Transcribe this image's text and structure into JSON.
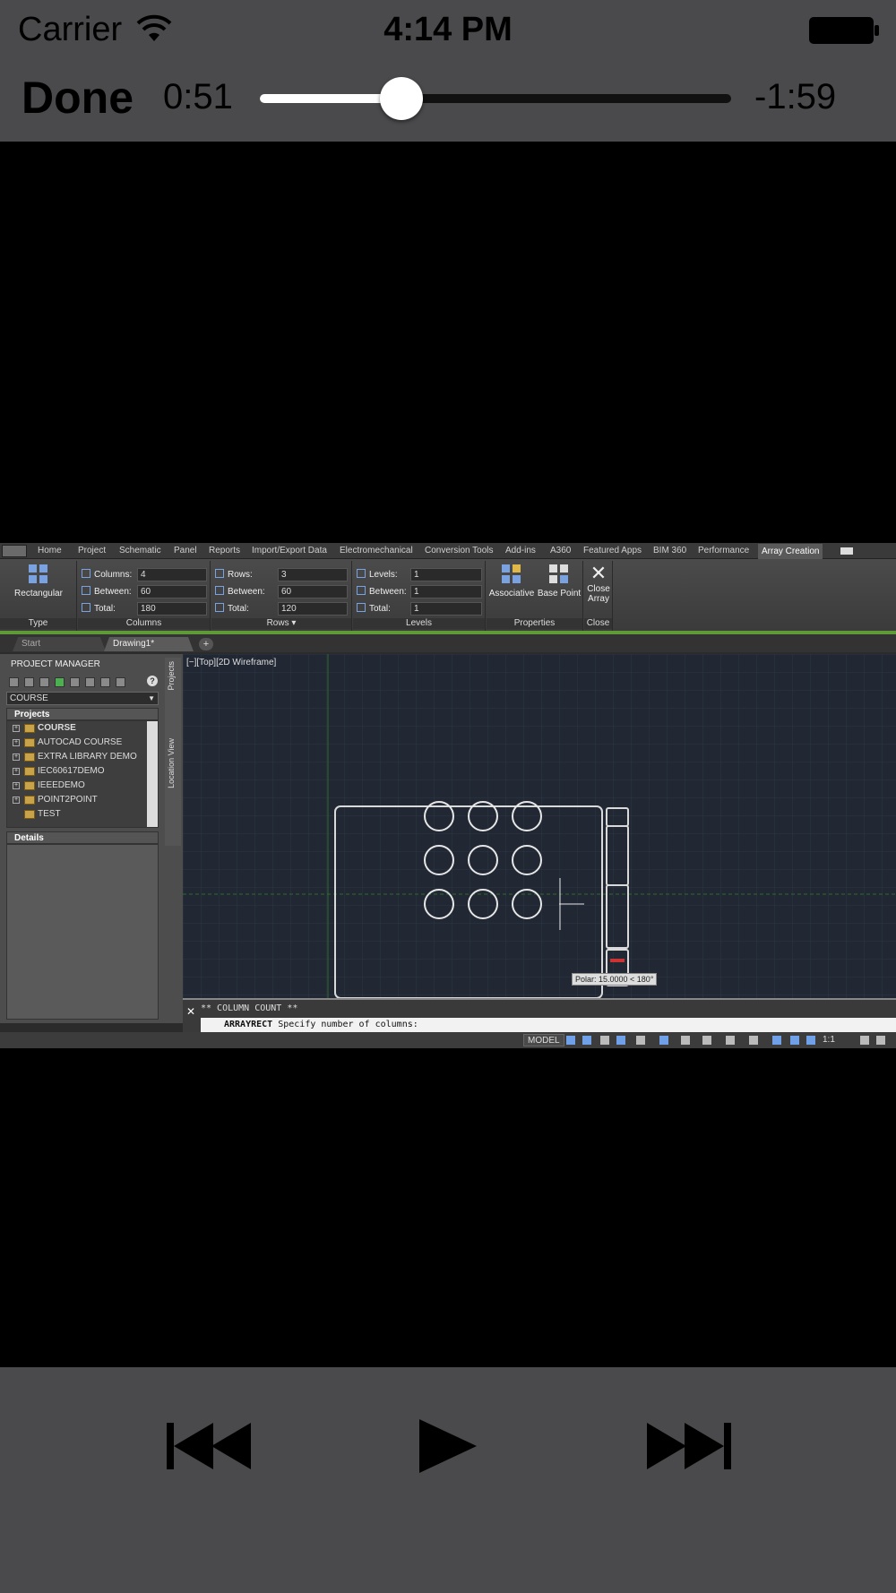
{
  "status": {
    "carrier": "Carrier",
    "time": "4:14 PM"
  },
  "player": {
    "done_label": "Done",
    "elapsed": "0:51",
    "remaining": "-1:59",
    "progress": 0.3
  },
  "autocad": {
    "ribbon_tabs": [
      "Home",
      "Project",
      "Schematic",
      "Panel",
      "Reports",
      "Import/Export Data",
      "Electromechanical",
      "Conversion Tools",
      "Add-ins",
      "A360",
      "Featured Apps",
      "BIM 360",
      "Performance",
      "Array Creation"
    ],
    "active_tab": "Array Creation",
    "type_panel": {
      "button": "Rectangular",
      "label": "Type"
    },
    "columns_panel": {
      "label": "Columns",
      "columns_label": "Columns:",
      "columns": "4",
      "between_label": "Between:",
      "between": "60",
      "total_label": "Total:",
      "total": "180"
    },
    "rows_panel": {
      "label": "Rows",
      "rows_label": "Rows:",
      "rows": "3",
      "between_label": "Between:",
      "between": "60",
      "total_label": "Total:",
      "total": "120"
    },
    "levels_panel": {
      "label": "Levels",
      "levels_label": "Levels:",
      "levels": "1",
      "between_label": "Between:",
      "between": "1",
      "total_label": "Total:",
      "total": "1"
    },
    "properties_panel": {
      "label": "Properties",
      "associative": "Associative",
      "base_point": "Base Point"
    },
    "close_panel": {
      "label": "Close",
      "button": "Close Array"
    },
    "doc_tabs": [
      "Start",
      "Drawing1*"
    ],
    "project_manager": {
      "title": "PROJECT MANAGER",
      "combo": "COURSE",
      "projects_header": "Projects",
      "projects": [
        "COURSE",
        "AUTOCAD COURSE",
        "EXTRA LIBRARY DEMO",
        "IEC60617DEMO",
        "IEEEDEMO",
        "POINT2POINT",
        "TEST"
      ],
      "details_header": "Details"
    },
    "side_tabs": {
      "projects": "Projects",
      "location": "Location View"
    },
    "viewport_label": "[−][Top][2D Wireframe]",
    "tooltip": "Polar: 15.0000 < 180°",
    "cmd": {
      "history": "** COLUMN COUNT **",
      "command": "ARRAYRECT",
      "prompt": "Specify number of columns:"
    },
    "statusbar": {
      "model": "MODEL",
      "scale": "1:1"
    }
  },
  "colors": {
    "ios_bar": "#4a4a4c",
    "ribbon_accent": "#5e9a35",
    "canvas_bg": "#212834"
  }
}
